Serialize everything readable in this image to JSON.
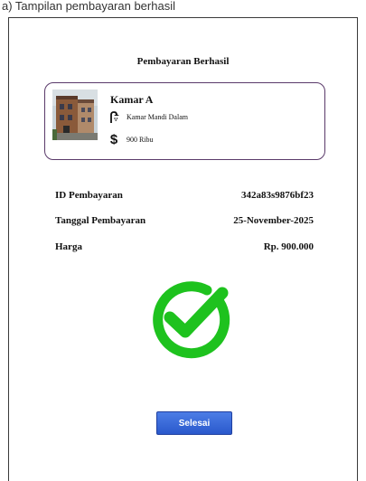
{
  "header_text": "a) Tampilan pembayaran berhasil",
  "title": "Pembayaran Berhasil",
  "room": {
    "name": "Kamar A",
    "facility": "Kamar Mandi Dalam",
    "facility_icon": "shower-icon",
    "price": "900 Ribu",
    "price_icon": "dollar-icon"
  },
  "details": [
    {
      "label": "ID Pembayaran",
      "value": "342a83s9876bf23"
    },
    {
      "label": "Tanggal Pembayaran",
      "value": "25-November-2025"
    },
    {
      "label": "Harga",
      "value": "Rp. 900.000"
    }
  ],
  "success_icon": "check-circle-icon",
  "finish_button": "Selesai",
  "colors": {
    "card_border": "#5a3a6a",
    "success_green": "#1ec21e",
    "button_blue": "#2f62d6"
  }
}
